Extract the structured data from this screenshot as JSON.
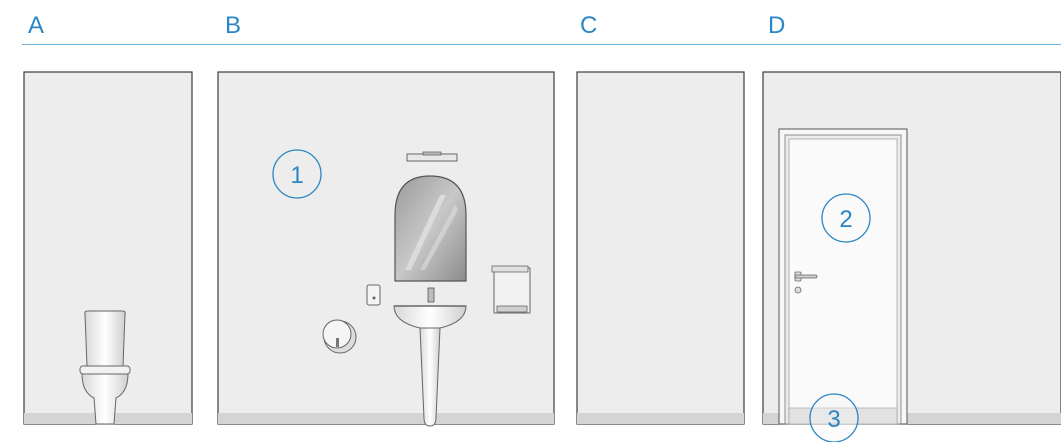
{
  "walls": [
    {
      "label": "A"
    },
    {
      "label": "B"
    },
    {
      "label": "C"
    },
    {
      "label": "D"
    }
  ],
  "callouts": [
    {
      "number": "1"
    },
    {
      "number": "2"
    },
    {
      "number": "3"
    }
  ],
  "colors": {
    "accent": "#2a86c4",
    "wall_fill": "#ededed",
    "floor": "#d4d4d4",
    "outline": "#3c3c3c"
  }
}
